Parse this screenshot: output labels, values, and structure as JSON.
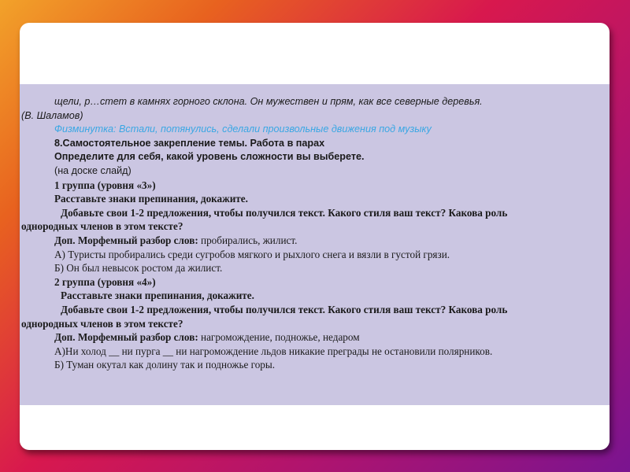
{
  "lines": {
    "l1": "щели, р…стет в камнях горного склона. Он мужествен и прям, как все северные деревья.",
    "l2": "(В. Шаламов)",
    "l3": "Физминутка: Встали, потянулись, сделали произвольные движения под музыку",
    "l4": "8.Самостоятельное закрепление темы. Работа в парах",
    "l5": "Определите для себя, какой уровень сложности вы выберете.",
    "l6": "(на доске слайд)",
    "l7": "1 группа (уровня «3»)",
    "l8": "Расставьте знаки препинания, докажите.",
    "l9a": "Добавьте свои 1-2 предложения, чтобы получился текст. Какого стиля ваш текст? Какова роль",
    "l9b": "однородных членов в этом тексте?",
    "l10_label": "Доп. Морфемный разбор слов:",
    "l10_words": " пробирались, жилист.",
    "l11": "А) Туристы пробирались среди сугробов мягкого и рыхлого снега  и вязли в густой грязи.",
    "l12": "Б) Он был невысок ростом  да жилист.",
    "l13": "2 группа (уровня «4»)",
    "l14": "Расставьте знаки препинания, докажите.",
    "l15a": "Добавьте свои 1-2 предложения, чтобы получился текст. Какого стиля ваш текст? Какова роль",
    "l15b": "однородных членов в этом тексте?",
    "l16_label": "Доп. Морфемный разбор слов:",
    "l16_words": " нагромождение, подножье, недаром",
    "l17": "А)Ни холод __ ни пурга __ ни нагромождение льдов  никакие преграды не остановили полярников.",
    "l18": "Б) Туман окутал как долину  так и подножье горы."
  },
  "colors": {
    "panel": "#cbc6e2",
    "accent_blue": "#3aa7e4"
  }
}
